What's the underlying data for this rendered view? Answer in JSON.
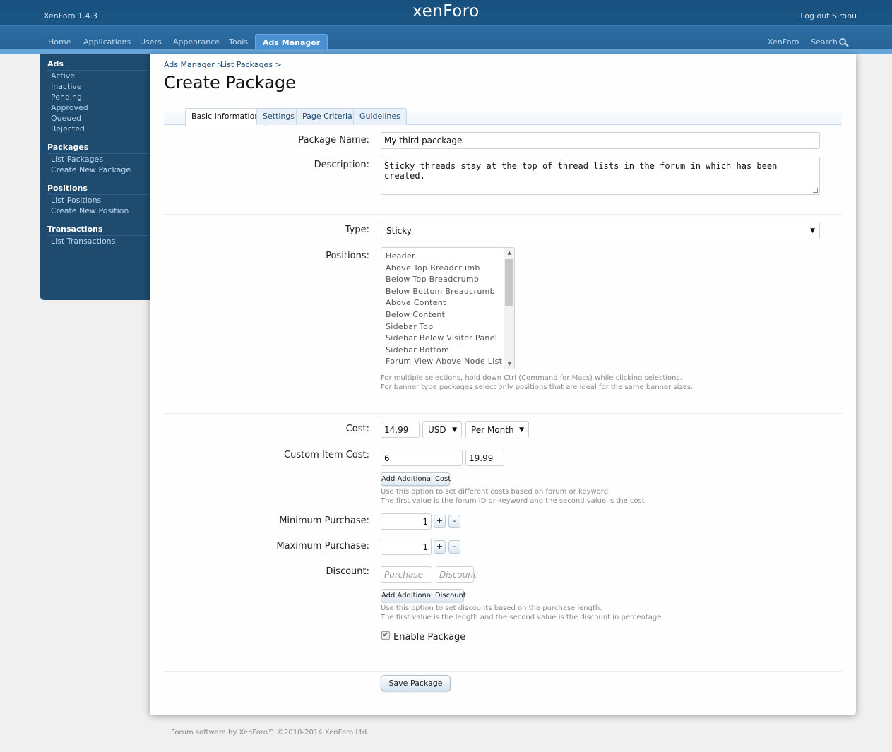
{
  "header": {
    "version": "XenForo 1.4.3",
    "logo": "xenForo",
    "logout": "Log out Siropu"
  },
  "nav": {
    "items": [
      "Home",
      "Applications",
      "Users",
      "Appearance",
      "Tools"
    ],
    "active": "Ads Manager",
    "right": [
      "XenForo",
      "Search"
    ]
  },
  "sidebar": {
    "ads": {
      "title": "Ads",
      "items": [
        "Active",
        "Inactive",
        "Pending",
        "Approved",
        "Queued",
        "Rejected"
      ]
    },
    "packages": {
      "title": "Packages",
      "items": [
        "List Packages",
        "Create New Package"
      ]
    },
    "positions": {
      "title": "Positions",
      "items": [
        "List Positions",
        "Create New Position"
      ]
    },
    "transactions": {
      "title": "Transactions",
      "items": [
        "List Transactions"
      ]
    }
  },
  "breadcrumb": [
    "Ads Manager >",
    "List Packages >"
  ],
  "page_title": "Create Package",
  "tabs": [
    "Basic Information",
    "Settings",
    "Page Criteria",
    "Guidelines"
  ],
  "form": {
    "package_name_label": "Package Name:",
    "package_name_value": "My third pacckage",
    "description_label": "Description:",
    "description_value": "Sticky threads stay at the top of thread lists in the forum in which has been created.",
    "type_label": "Type:",
    "type_value": "Sticky",
    "positions_label": "Positions:",
    "positions_options": [
      "Header",
      "Above Top Breadcrumb",
      "Below Top Breadcrumb",
      "Below Bottom Breadcrumb",
      "Above Content",
      "Below Content",
      "Sidebar Top",
      "Sidebar Below Visitor Panel",
      "Sidebar Bottom",
      "Forum View Above Node List"
    ],
    "positions_hint_1": "For multiple selections, hold down Ctrl (Command for Macs) while clicking selections.",
    "positions_hint_2": "For banner type packages select only positions that are ideal for the same banner sizes.",
    "cost_label": "Cost:",
    "cost_value": "14.99",
    "currency_value": "USD",
    "period_value": "Per Month",
    "custom_cost_label": "Custom Item Cost:",
    "custom_cost_key": "6",
    "custom_cost_value": "19.99",
    "add_cost_button": "Add Additional Cost",
    "custom_cost_hint_1": "Use this option to set different costs based on forum or keyword.",
    "custom_cost_hint_2": "The first value is the forum ID or keyword and the second value is the cost.",
    "min_purchase_label": "Minimum Purchase:",
    "min_purchase_value": "1",
    "max_purchase_label": "Maximum Purchase:",
    "max_purchase_value": "1",
    "plus": "+",
    "minus": "-",
    "discount_label": "Discount:",
    "discount_purchase_placeholder": "Purchase",
    "discount_discount_placeholder": "Discount",
    "add_discount_button": "Add Additional Discount",
    "discount_hint_1": "Use this option to set discounts based on the purchase length.",
    "discount_hint_2": "The first value is the length and the second value is the discount in percentage.",
    "enable_label": "Enable Package",
    "enable_checked": true,
    "save_button": "Save Package"
  },
  "footer": "Forum software by XenForo™ ©2010-2014 XenForo Ltd."
}
